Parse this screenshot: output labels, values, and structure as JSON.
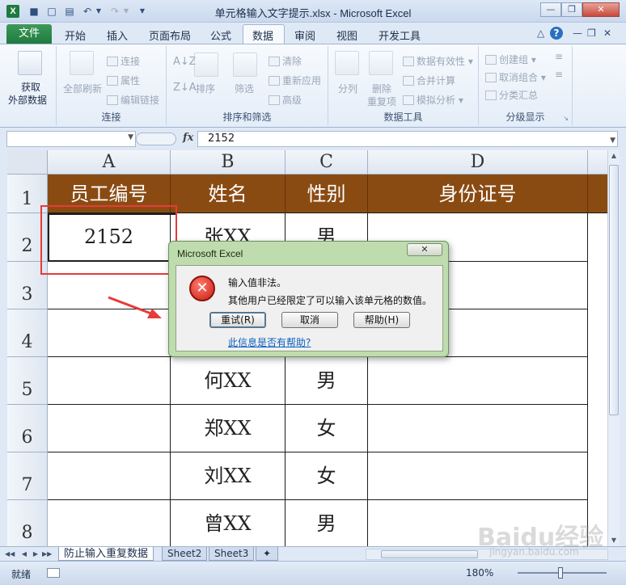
{
  "window": {
    "title": "单元格输入文字提示.xlsx - Microsoft Excel",
    "app_letter": "X"
  },
  "ribbon": {
    "tabs": {
      "file": "文件",
      "home": "开始",
      "insert": "插入",
      "page_layout": "页面布局",
      "formulas": "公式",
      "data": "数据",
      "review": "审阅",
      "view": "视图",
      "developer": "开发工具"
    },
    "groups": {
      "get_external": {
        "btn_line1": "获取",
        "btn_line2": "外部数据"
      },
      "connections": {
        "label": "连接",
        "refresh_all": "全部刷新",
        "connections": "连接",
        "properties": "属性",
        "edit_links": "编辑链接"
      },
      "sort_filter": {
        "label": "排序和筛选",
        "sort": "排序",
        "filter": "筛选",
        "clear": "清除",
        "reapply": "重新应用",
        "advanced": "高级"
      },
      "data_tools": {
        "label": "数据工具",
        "text_to_columns": "分列",
        "remove_duplicates_1": "删除",
        "remove_duplicates_2": "重复项",
        "data_validation": "数据有效性",
        "consolidate": "合并计算",
        "what_if": "模拟分析"
      },
      "outline": {
        "label": "分级显示",
        "group": "创建组",
        "ungroup": "取消组合",
        "subtotal": "分类汇总"
      }
    }
  },
  "formula_bar": {
    "fx": "fx",
    "value": "2152"
  },
  "sheet": {
    "columns": [
      "A",
      "B",
      "C",
      "D"
    ],
    "rows": [
      "1",
      "2",
      "3",
      "4",
      "5",
      "6",
      "7",
      "8"
    ],
    "header": [
      "员工编号",
      "姓名",
      "性别",
      "身份证号"
    ],
    "data": [
      [
        "2152",
        "张XX",
        "男",
        ""
      ],
      [
        "",
        "",
        "",
        ""
      ],
      [
        "",
        "",
        "",
        ""
      ],
      [
        "",
        "何XX",
        "男",
        ""
      ],
      [
        "",
        "郑XX",
        "女",
        ""
      ],
      [
        "",
        "刘XX",
        "女",
        ""
      ],
      [
        "",
        "曾XX",
        "男",
        ""
      ]
    ],
    "header_color": "#8a4b12"
  },
  "sheet_tabs": [
    "防止输入重复数据",
    "Sheet2",
    "Sheet3"
  ],
  "status": {
    "ready": "就绪",
    "zoom": "180%"
  },
  "dialog": {
    "title": "Microsoft Excel",
    "message_1": "输入值非法。",
    "message_2": "其他用户已经限定了可以输入该单元格的数值。",
    "retry": "重试(R)",
    "cancel": "取消",
    "help": "帮助(H)",
    "link": "此信息是否有帮助?",
    "icon": "error-icon"
  },
  "watermark": {
    "text": "Baidu经验",
    "url": "jingyan.baidu.com"
  }
}
